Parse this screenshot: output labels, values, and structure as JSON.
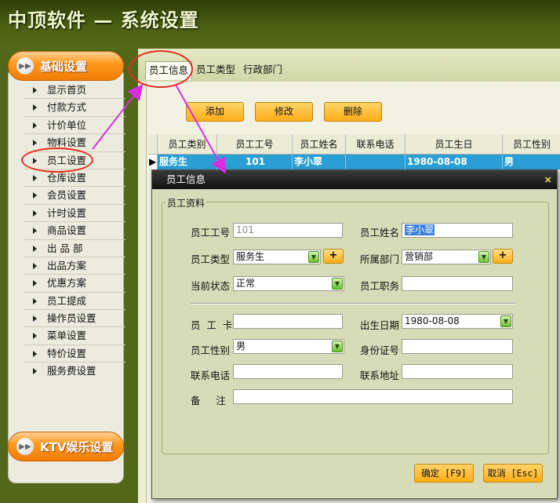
{
  "app": {
    "title": "中顶软件 — 系统设置"
  },
  "sidebar": {
    "top_button": "基础设置",
    "bottom_button": "KTV娱乐设置",
    "items": [
      "显示首页",
      "付款方式",
      "计价单位",
      "物料设置",
      "员工设置",
      "仓库设置",
      "会员设置",
      "计时设置",
      "商品设置",
      "出 品 部",
      "出品方案",
      "优惠方案",
      "员工提成",
      "操作员设置",
      "菜单设置",
      "特价设置",
      "服务费设置"
    ]
  },
  "tabs": [
    "员工信息",
    "员工类型",
    "行政部门"
  ],
  "toolbar": {
    "add": "添加",
    "edit": "修改",
    "delete": "删除"
  },
  "grid": {
    "columns": [
      "员工类别",
      "员工工号",
      "员工姓名",
      "联系电话",
      "员工生日",
      "员工性别"
    ],
    "rows": [
      [
        "服务生",
        "101",
        "李小翠",
        "",
        "1980-08-08",
        "男"
      ]
    ]
  },
  "dialog": {
    "title": "员工信息",
    "close": "×",
    "group": "员工资料",
    "fields": {
      "emp_no": {
        "label": "员工工号",
        "value": "101"
      },
      "emp_name": {
        "label": "员工姓名",
        "value": "李小翠"
      },
      "emp_type": {
        "label": "员工类型",
        "value": "服务生"
      },
      "dept": {
        "label": "所属部门",
        "value": "营销部"
      },
      "status": {
        "label": "当前状态",
        "value": "正常"
      },
      "position": {
        "label": "员工职务",
        "value": ""
      },
      "card": {
        "label": "员  工  卡",
        "value": ""
      },
      "birthday": {
        "label": "出生日期",
        "value": "1980-08-08"
      },
      "gender": {
        "label": "员工性别",
        "value": "男"
      },
      "id_no": {
        "label": "身份证号",
        "value": ""
      },
      "phone": {
        "label": "联系电话",
        "value": ""
      },
      "address": {
        "label": "联系地址",
        "value": ""
      },
      "remark": {
        "label": "备     注",
        "value": ""
      }
    },
    "plus": "+",
    "ok": "确定 [F9]",
    "cancel": "取消 [Esc]"
  },
  "colors": {
    "accent_orange": "#ffad16",
    "highlight_blue": "#2a9fd4",
    "annotation_red": "#e82a1e",
    "arrow_magenta": "#d92ee0"
  }
}
